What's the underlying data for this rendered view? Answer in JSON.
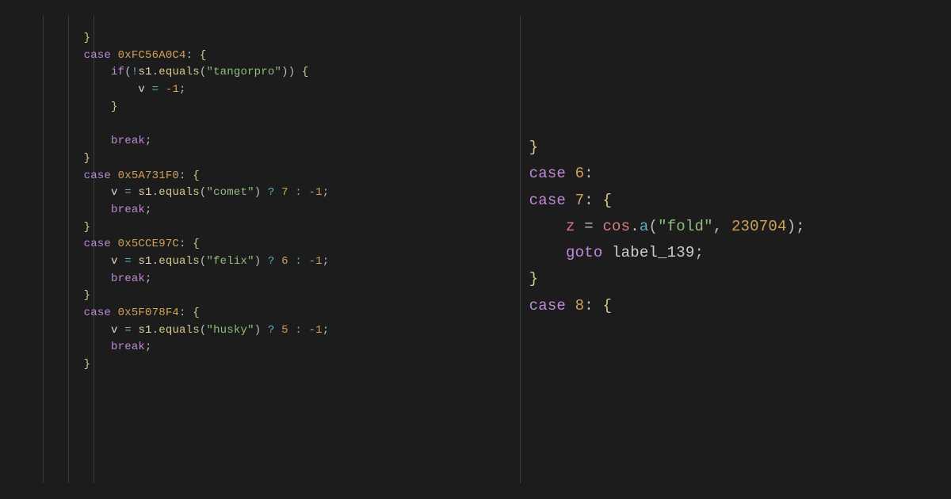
{
  "left": {
    "kw_case": "case",
    "kw_if": "if",
    "kw_break": "break",
    "hex1": "0xFC56A0C4",
    "hex2": "0x5A731F0",
    "hex3": "0x5CCE97C",
    "hex4": "0x5F078F4",
    "id_s1": "s1",
    "fn_equals": "equals",
    "str_tangorpro": "\"tangorpro\"",
    "str_comet": "\"comet\"",
    "str_felix": "\"felix\"",
    "str_husky": "\"husky\"",
    "var_v": "v",
    "op_assign": " = ",
    "op_neg1": "-1",
    "op_q": " ? ",
    "op_colon": " : ",
    "n7": "7",
    "n6": "6",
    "n5": "5",
    "lbrace": "{",
    "rbrace": "}",
    "lparen": "(",
    "rparen": ")",
    "bang": "!",
    "dot": ".",
    "semi": ";",
    "comma": ", ",
    "colon_after_hex": ": "
  },
  "right": {
    "kw_case": "case",
    "kw_goto": "goto",
    "n6": "6",
    "n7": "7",
    "n8": "8",
    "id_z": "z",
    "id_cos": "cos",
    "fn_a": "a",
    "str_fold": "\"fold\"",
    "num_230704": "230704",
    "label_139": "label_139",
    "lbrace": "{",
    "rbrace": "}",
    "lparen": "(",
    "rparen": ")",
    "dot": ".",
    "semi": ";",
    "comma": ", ",
    "colon": ":",
    "op_assign": " = "
  }
}
